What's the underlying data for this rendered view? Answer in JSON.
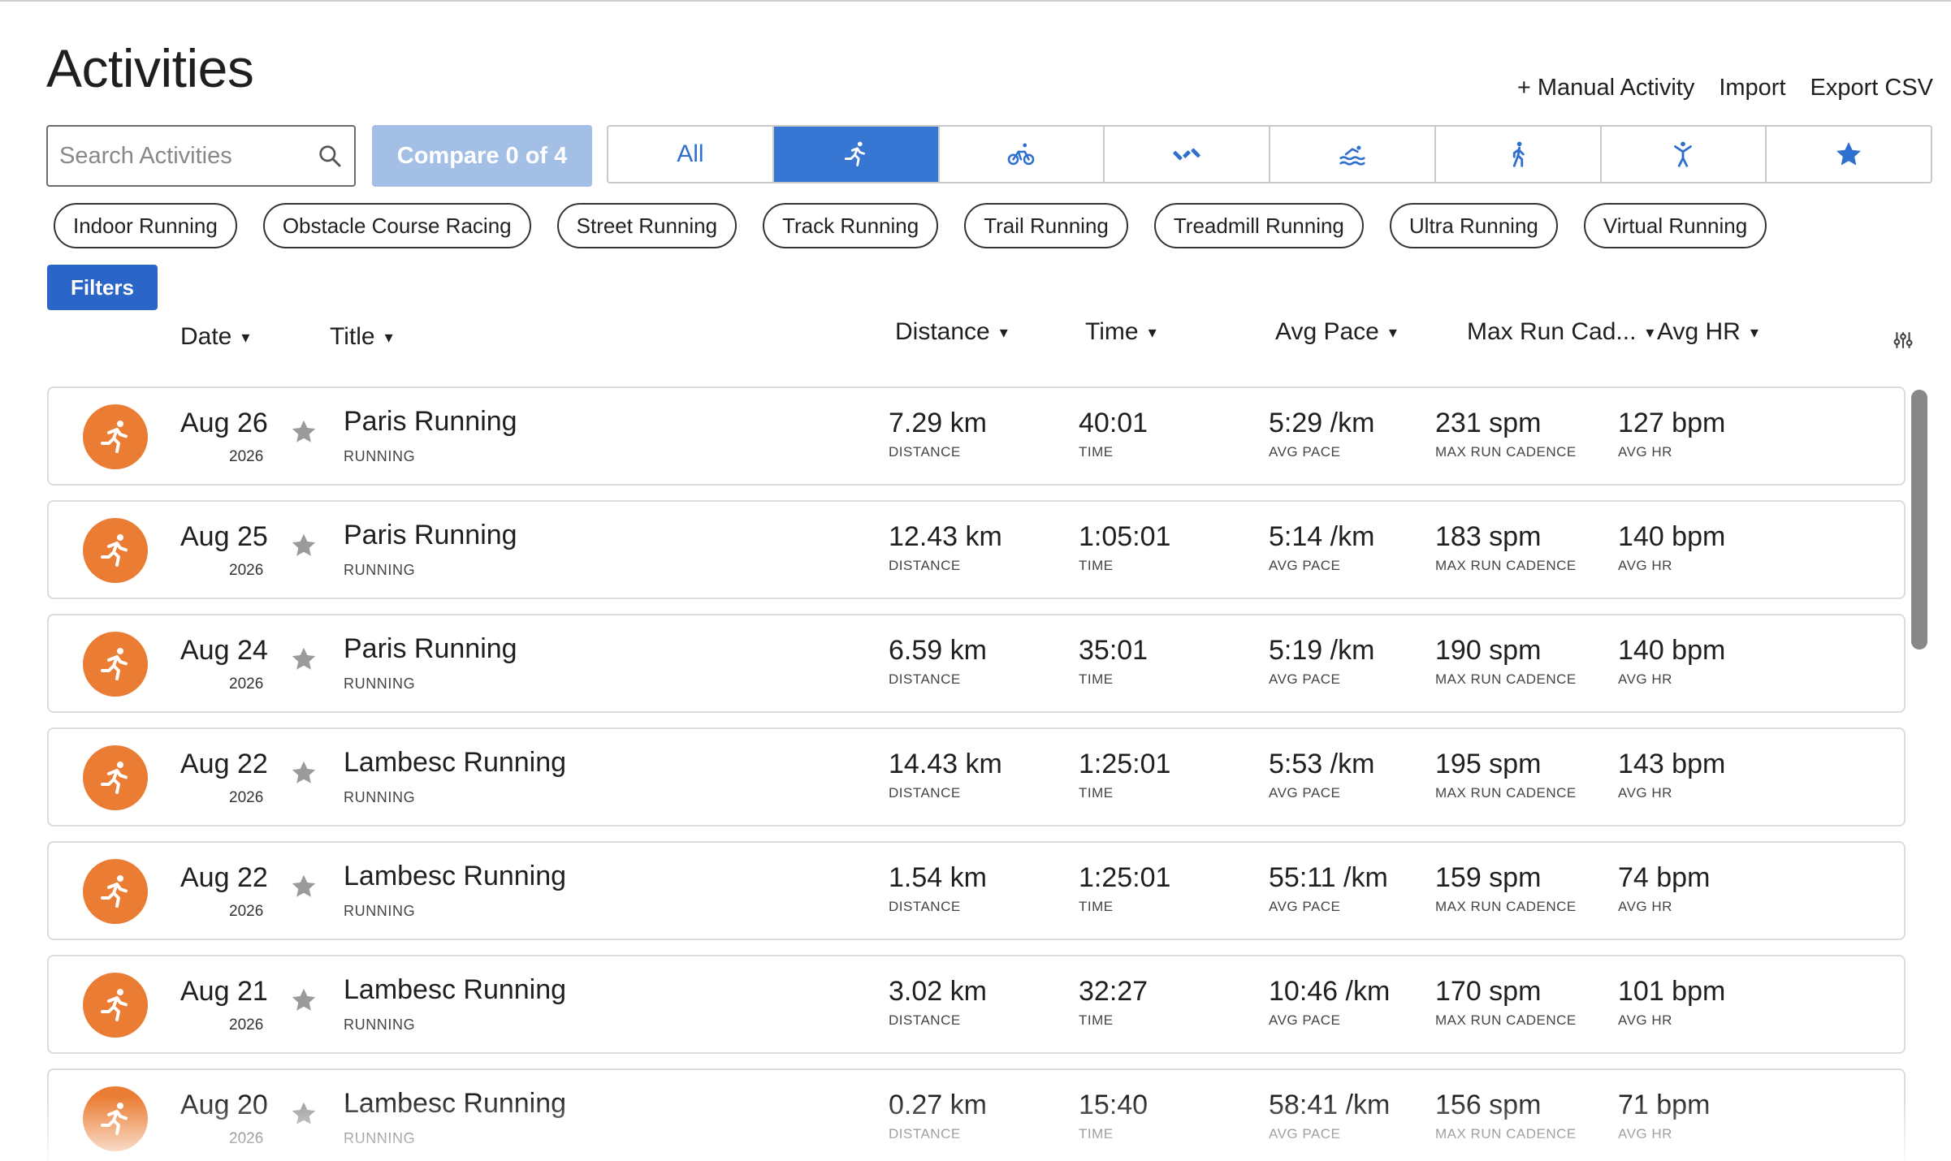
{
  "page": {
    "title": "Activities"
  },
  "actions": {
    "manual_activity": "+ Manual Activity",
    "import": "Import",
    "export_csv": "Export CSV"
  },
  "search": {
    "placeholder": "Search Activities",
    "value": ""
  },
  "compare": {
    "label": "Compare 0 of 4"
  },
  "type_tabs": [
    {
      "label": "All",
      "icon": "all",
      "active": false
    },
    {
      "label": "",
      "icon": "running-icon",
      "active": true
    },
    {
      "label": "",
      "icon": "cycling-icon",
      "active": false
    },
    {
      "label": "",
      "icon": "strength-icon",
      "active": false
    },
    {
      "label": "",
      "icon": "swimming-icon",
      "active": false
    },
    {
      "label": "",
      "icon": "walking-icon",
      "active": false
    },
    {
      "label": "",
      "icon": "yoga-icon",
      "active": false
    },
    {
      "label": "",
      "icon": "star-icon",
      "active": false
    }
  ],
  "chips": [
    "Indoor Running",
    "Obstacle Course Racing",
    "Street Running",
    "Track Running",
    "Trail Running",
    "Treadmill Running",
    "Ultra Running",
    "Virtual Running"
  ],
  "filters": {
    "label": "Filters"
  },
  "columns": {
    "date": "Date",
    "title": "Title",
    "distance": "Distance",
    "time": "Time",
    "avg_pace": "Avg Pace",
    "max_run_cadence": "Max Run Cad...",
    "avg_hr": "Avg HR",
    "caret": "▾"
  },
  "metric_labels": {
    "distance": "DISTANCE",
    "time": "TIME",
    "avg_pace": "AVG PACE",
    "max_run_cadence": "MAX RUN CADENCE",
    "avg_hr": "AVG HR"
  },
  "activities": [
    {
      "date": "Aug 26",
      "year": "2026",
      "title": "Paris Running",
      "type": "RUNNING",
      "distance": "7.29 km",
      "time": "40:01",
      "avg_pace": "5:29 /km",
      "max_run_cadence": "231 spm",
      "avg_hr": "127 bpm"
    },
    {
      "date": "Aug 25",
      "year": "2026",
      "title": "Paris Running",
      "type": "RUNNING",
      "distance": "12.43 km",
      "time": "1:05:01",
      "avg_pace": "5:14 /km",
      "max_run_cadence": "183 spm",
      "avg_hr": "140 bpm"
    },
    {
      "date": "Aug 24",
      "year": "2026",
      "title": "Paris Running",
      "type": "RUNNING",
      "distance": "6.59 km",
      "time": "35:01",
      "avg_pace": "5:19 /km",
      "max_run_cadence": "190 spm",
      "avg_hr": "140 bpm"
    },
    {
      "date": "Aug 22",
      "year": "2026",
      "title": "Lambesc Running",
      "type": "RUNNING",
      "distance": "14.43 km",
      "time": "1:25:01",
      "avg_pace": "5:53 /km",
      "max_run_cadence": "195 spm",
      "avg_hr": "143 bpm"
    },
    {
      "date": "Aug 22",
      "year": "2026",
      "title": "Lambesc Running",
      "type": "RUNNING",
      "distance": "1.54 km",
      "time": "1:25:01",
      "avg_pace": "55:11 /km",
      "max_run_cadence": "159 spm",
      "avg_hr": "74 bpm"
    },
    {
      "date": "Aug 21",
      "year": "2026",
      "title": "Lambesc Running",
      "type": "RUNNING",
      "distance": "3.02 km",
      "time": "32:27",
      "avg_pace": "10:46 /km",
      "max_run_cadence": "170 spm",
      "avg_hr": "101 bpm"
    },
    {
      "date": "Aug 20",
      "year": "2026",
      "title": "Lambesc Running",
      "type": "RUNNING",
      "distance": "0.27 km",
      "time": "15:40",
      "avg_pace": "58:41 /km",
      "max_run_cadence": "156 spm",
      "avg_hr": "71 bpm"
    }
  ],
  "colors": {
    "accent": "#3876d4",
    "compare_disabled": "#a3bfe6",
    "activity_badge": "#ea7c33",
    "star_inactive": "#9a9a9a"
  }
}
